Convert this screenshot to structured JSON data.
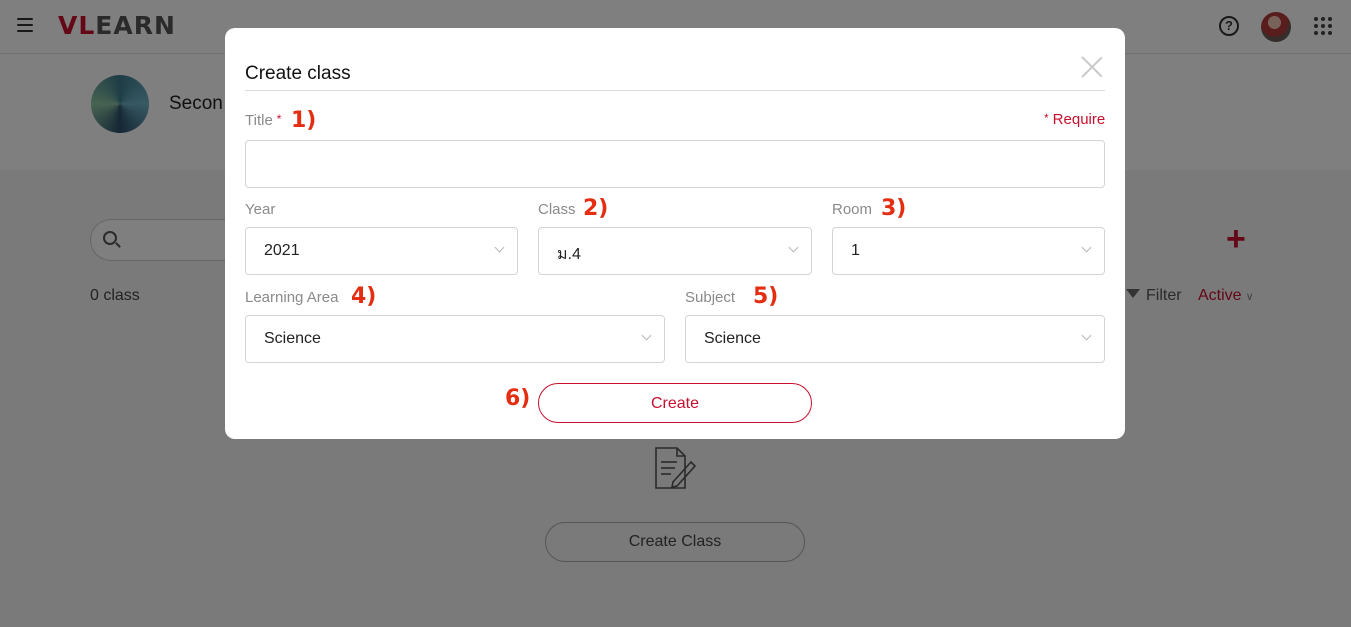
{
  "app": {
    "logo": "VLEARN",
    "logo_accent": "VL"
  },
  "header": {
    "menu_icon": "menu-icon",
    "help_icon": "help-circle-icon",
    "apps_icon": "apps-grid-icon"
  },
  "school": {
    "name": "Secon"
  },
  "toolbar": {
    "class_count": "0 class",
    "filter_label": "Filter",
    "status_value": "Active",
    "add_icon": "plus-icon"
  },
  "empty_state": {
    "button_label": "Create Class",
    "icon": "document-edit-icon"
  },
  "colors": {
    "accent": "#c8102e",
    "annotation": "#e52d12",
    "overlay": "rgba(0,0,0,0.5)"
  },
  "modal": {
    "title": "Create class",
    "require_note": "Require",
    "required_mark": "*",
    "fields": {
      "title": {
        "label": "Title",
        "value": "",
        "annotation": "1)"
      },
      "year": {
        "label": "Year",
        "value": "2021"
      },
      "class": {
        "label": "Class",
        "value": "ม.4",
        "annotation": "2)"
      },
      "room": {
        "label": "Room",
        "value": "1",
        "annotation": "3)"
      },
      "learning_area": {
        "label": "Learning Area",
        "value": "Science",
        "annotation": "4)"
      },
      "subject": {
        "label": "Subject",
        "value": "Science",
        "annotation": "5)"
      }
    },
    "create_button": {
      "label": "Create",
      "annotation": "6)"
    }
  }
}
